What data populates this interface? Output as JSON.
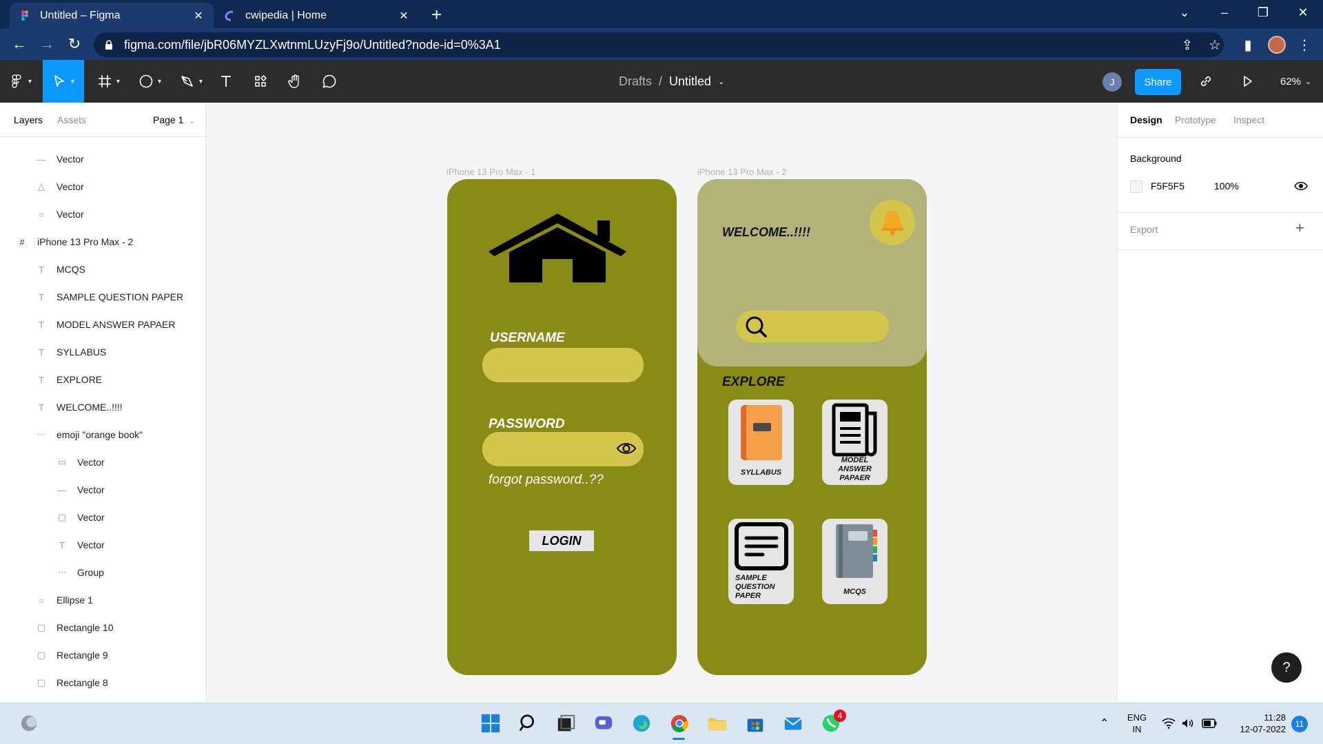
{
  "browser": {
    "tabs": [
      {
        "title": "Untitled – Figma",
        "active": true
      },
      {
        "title": "cwipedia | Home",
        "active": false
      }
    ],
    "url": "figma.com/file/jbR06MYZLXwtnmLUzyFj9o/Untitled?node-id=0%3A1"
  },
  "figma": {
    "breadcrumb": {
      "folder": "Drafts",
      "separator": "/",
      "file": "Untitled"
    },
    "avatar_initial": "J",
    "share_label": "Share",
    "zoom": "62%",
    "left_tabs": {
      "layers": "Layers",
      "assets": "Assets",
      "page": "Page 1"
    },
    "layers": [
      {
        "name": "Vector",
        "icon": "line-icon",
        "indent": 1
      },
      {
        "name": "Vector",
        "icon": "triangle-icon",
        "indent": 1
      },
      {
        "name": "Vector",
        "icon": "circle-icon",
        "indent": 1
      },
      {
        "name": "iPhone 13 Pro Max - 2",
        "icon": "frame-icon",
        "indent": 0
      },
      {
        "name": "MCQS",
        "icon": "text-icon",
        "indent": 1
      },
      {
        "name": "SAMPLE QUESTION PAPER",
        "icon": "text-icon",
        "indent": 1
      },
      {
        "name": "MODEL ANSWER PAPAER",
        "icon": "text-icon",
        "indent": 1
      },
      {
        "name": "SYLLABUS",
        "icon": "text-icon",
        "indent": 1
      },
      {
        "name": "EXPLORE",
        "icon": "text-icon",
        "indent": 1
      },
      {
        "name": "WELCOME..!!!!",
        "icon": "text-icon",
        "indent": 1
      },
      {
        "name": "emoji \"orange book\"",
        "icon": "group-icon",
        "indent": 1
      },
      {
        "name": "Vector",
        "icon": "rectangle-icon",
        "indent": 2
      },
      {
        "name": "Vector",
        "icon": "line-icon",
        "indent": 2
      },
      {
        "name": "Vector",
        "icon": "square-icon",
        "indent": 2
      },
      {
        "name": "Vector",
        "icon": "text-icon",
        "indent": 2
      },
      {
        "name": "Group",
        "icon": "group-icon",
        "indent": 2
      },
      {
        "name": "Ellipse 1",
        "icon": "circle-icon",
        "indent": 1
      },
      {
        "name": "Rectangle 10",
        "icon": "square-icon",
        "indent": 1
      },
      {
        "name": "Rectangle 9",
        "icon": "square-icon",
        "indent": 1
      },
      {
        "name": "Rectangle 8",
        "icon": "square-icon",
        "indent": 1
      }
    ],
    "right_tabs": {
      "design": "Design",
      "prototype": "Prototype",
      "inspect": "Inspect"
    },
    "background_label": "Background",
    "background_hex": "F5F5F5",
    "background_opacity": "100%",
    "export_label": "Export",
    "help_label": "?"
  },
  "frames": {
    "frame1": {
      "label": "iPhone 13 Pro Max - 1",
      "username_label": "USERNAME",
      "password_label": "PASSWORD",
      "forgot": "forgot password..??",
      "login": "LOGIN"
    },
    "frame2": {
      "label": "iPhone 13 Pro Max - 2",
      "welcome": "WELCOME..!!!!",
      "explore": "EXPLORE",
      "cards": {
        "syllabus": "SYLLABUS",
        "model": [
          "MODEL",
          "ANSWER",
          "PAPAER"
        ],
        "sample": [
          "SAMPLE",
          "QUESTION",
          "PAPER"
        ],
        "mcqs": "MCQS"
      }
    }
  },
  "taskbar": {
    "lang": [
      "ENG",
      "IN"
    ],
    "time": "11:28",
    "date": "12-07-2022",
    "whatsapp_badge": "4",
    "notification_count": "11"
  },
  "colors": {
    "olive": "#8a8a16",
    "input_yellow": "#d4c54c",
    "header_khaki": "#b3b278",
    "figma_blue": "#0d99ff",
    "toolbar_dark": "#2c2c2c",
    "chrome_navy": "#0f2a52"
  }
}
